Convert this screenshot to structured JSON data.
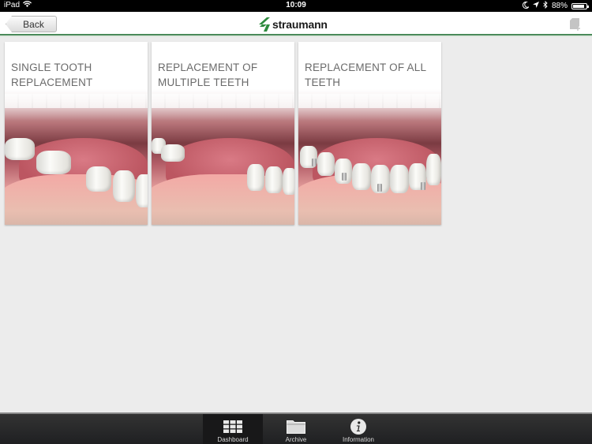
{
  "status_bar": {
    "device": "iPad",
    "time": "10:09",
    "battery_percent": "88%",
    "battery_level": 0.88,
    "icons": [
      "wifi-icon",
      "moon-icon",
      "location-arrow-icon",
      "bluetooth-icon",
      "battery-icon"
    ]
  },
  "header": {
    "back_label": "Back",
    "logo_text": "straumann",
    "add_note_icon": "note-add-icon",
    "brand_color": "#2e8b3e",
    "border_color": "#4a8a5a"
  },
  "cards": [
    {
      "title": "SINGLE TOOTH REPLACEMENT",
      "image": "single-tooth-gap"
    },
    {
      "title": "REPLACEMENT OF MULTIPLE TEETH",
      "image": "multiple-teeth-gap"
    },
    {
      "title": "REPLACEMENT OF ALL TEETH",
      "image": "full-arch-implants"
    }
  ],
  "tabbar": {
    "active": "Dashboard",
    "tabs": [
      {
        "label": "Dashboard",
        "icon": "grid-icon"
      },
      {
        "label": "Archive",
        "icon": "folder-icon"
      },
      {
        "label": "Information",
        "icon": "info-icon"
      }
    ]
  }
}
